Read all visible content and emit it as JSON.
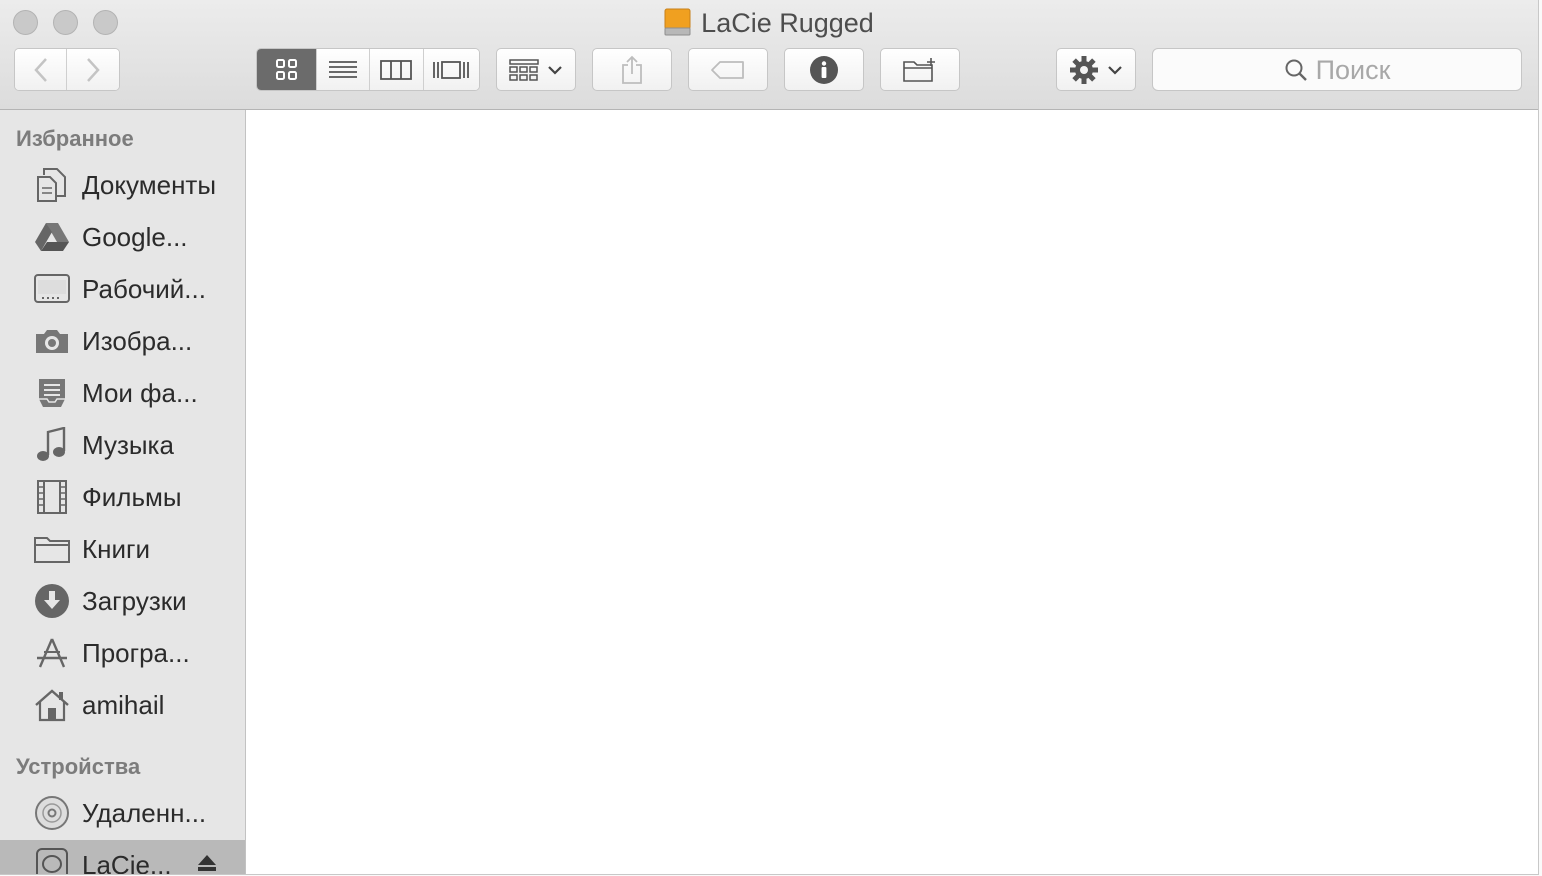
{
  "window": {
    "title": "LaCie Rugged"
  },
  "toolbar": {
    "search": {
      "placeholder": "Поиск"
    },
    "view_modes": [
      "icon-view",
      "list-view",
      "column-view",
      "cover-flow-view"
    ],
    "active_view": "icon-view"
  },
  "sidebar": {
    "favorites_header": "Избранное",
    "favorites": [
      {
        "label": "Документы",
        "icon": "documents-icon"
      },
      {
        "label": "Google...",
        "icon": "google-drive-icon"
      },
      {
        "label": "Рабочий...",
        "icon": "desktop-icon"
      },
      {
        "label": "Изобра...",
        "icon": "camera-icon"
      },
      {
        "label": "Мои фа...",
        "icon": "all-my-files-icon"
      },
      {
        "label": "Музыка",
        "icon": "music-icon"
      },
      {
        "label": "Фильмы",
        "icon": "film-icon"
      },
      {
        "label": "Книги",
        "icon": "folder-icon"
      },
      {
        "label": "Загрузки",
        "icon": "downloads-icon"
      },
      {
        "label": "Програ...",
        "icon": "applications-icon"
      },
      {
        "label": "amihail",
        "icon": "home-icon"
      }
    ],
    "devices_header": "Устройства",
    "devices": [
      {
        "label": "Удаленн...",
        "icon": "remote-disc-icon"
      },
      {
        "label": "LaCie...",
        "icon": "external-drive-icon",
        "selected": true
      }
    ]
  },
  "colors": {
    "accent_drive": "#f0a020",
    "sidebar_bg": "#e6e6e6",
    "selected_bg": "#b9b9b9"
  }
}
